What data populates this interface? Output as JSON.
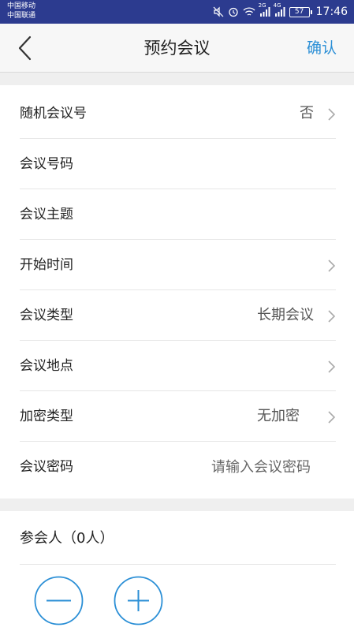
{
  "status_bar": {
    "carrier1": "中国移动",
    "carrier2": "中国联通",
    "net1": "2G",
    "net2": "4G",
    "battery": "57",
    "time": "17:46"
  },
  "nav": {
    "title": "预约会议",
    "confirm": "确认"
  },
  "form": {
    "random_id": {
      "label": "随机会议号",
      "value": "否"
    },
    "meeting_id": {
      "label": "会议号码"
    },
    "subject": {
      "label": "会议主题"
    },
    "start_time": {
      "label": "开始时间"
    },
    "type": {
      "label": "会议类型",
      "value": "长期会议"
    },
    "location": {
      "label": "会议地点"
    },
    "encryption": {
      "label": "加密类型",
      "value": "无加密"
    },
    "password": {
      "label": "会议密码",
      "placeholder": "请输入会议密码"
    }
  },
  "participants": {
    "header": "参会人（0人）"
  },
  "colors": {
    "status_bar": "#2c3b8f",
    "accent": "#2b8fd6"
  }
}
